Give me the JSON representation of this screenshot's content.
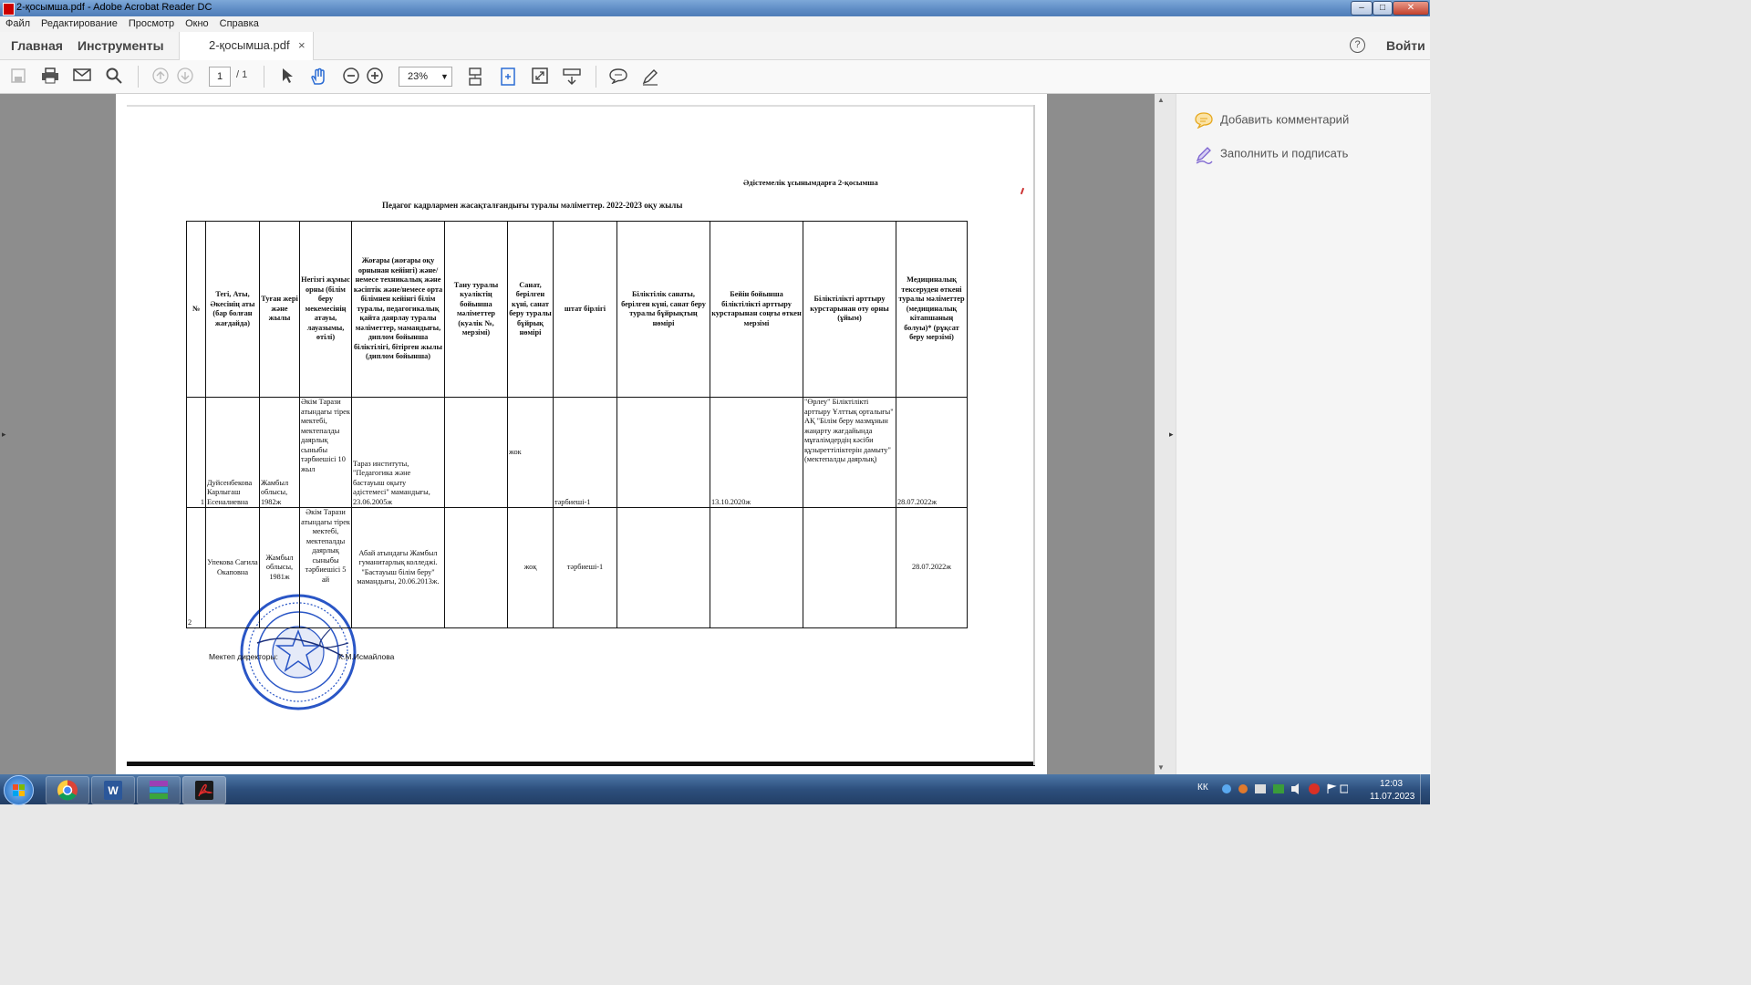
{
  "window": {
    "title": "2-қосымша.pdf - Adobe Acrobat Reader DC",
    "min": "–",
    "max": "□",
    "close": "✕"
  },
  "menu": [
    "Файл",
    "Редактирование",
    "Просмотр",
    "Окно",
    "Справка"
  ],
  "tabs": {
    "home": "Главная",
    "tools": "Инструменты",
    "doc": "2-қосымша.pdf",
    "close": "×",
    "help": "?",
    "signin": "Войти"
  },
  "toolbar": {
    "page_current": "1",
    "page_total": "/ 1",
    "zoom": "23%"
  },
  "right_panel": {
    "add_comment": "Добавить комментарий",
    "fill_sign": "Заполнить и подписать"
  },
  "document": {
    "appendix": "Әдістемелік ұсынымдарға 2-қосымша",
    "title": "Педагог кадрлармен жасақталғандығы туралы мәліметтер. 2022-2023 оқу жылы",
    "headers": [
      "№",
      "Тегі, Аты, Әкесінің аты (бар болған жағдайда)",
      "Туған жері және жылы",
      "Негізгі жұмыс орны (білім беру мекемесінің атауы, лауазымы, өтілі)",
      "Жоғары (жоғары оқу орнынан кейінгі) және/немесе техникалық және кәсіптік және/немесе орта білімнен кейінгі білім туралы, педагогикалық қайта даярлау туралы мәліметтер, мамандығы, диплом бойынша біліктілігі, бітірген жылы (диплом бойынша)",
      "Тану туралы куәліктің бойынша мәліметтер (куәлік №, мерзімі)",
      "Санат, берілген күні, санат беру туралы бұйрық нөмірі",
      "штат бірлігі",
      "Біліктілік санаты, берілген күні, санат беру туралы бұйрықтың нөмірі",
      "Бейін бойынша біліктілікті арттыру курстарынан соңғы өткен мерзімі",
      "Біліктілікті арттыру курстарынан оту орны (ұйым)",
      "Медициналық тексеруден өткені туралы мәліметтер (медициналық кітапшаның болуы)* (рұқсат беру мерзімі)"
    ],
    "rows": [
      {
        "no": "1",
        "name": "Дуйсенбекова Карлыгаш Есеналиевна",
        "birth": "Жамбыл облысы, 1982ж",
        "work": "Әкім Тарази атындағы тірек мектебі, мектепалды даярлық сыныбы тәрбиешісі 10 жыл",
        "education": "Тараз институты, \"Педагогика және бастауыш оқыту әдістемесі\" мамандығы, 23.06.2005ж",
        "recognition": "",
        "category": "жок",
        "staff": "тәрбиеші-1",
        "qual_category": "",
        "course_date": "13.10.2020ж",
        "course_place": "\"Өрлеу\" Біліктілікті арттыру Ұлттық орталығы\" АҚ \"Білім беру мазмұнын жаңарту жағдайында мұғалімдердің кәсіби құзыреттіліктерін дамыту\" (мектепалды даярлық)",
        "medical": "28.07.2022ж"
      },
      {
        "no": "2",
        "name": "Упекова Сағила Окаповна",
        "birth": "Жамбыл облысы, 1981ж",
        "work": "Әкім Тарази атындағы тірек мектебі, мектепалды даярлық сыныбы тәрбиешісі 5 ай",
        "education": "Абай атындағы Жамбыл гуманитарлық колледжі. \"Бастауыш білім беру\" мамандығы, 20.06.2013ж.",
        "recognition": "",
        "category": "жоқ",
        "staff": "тәрбиеші-1",
        "qual_category": "",
        "course_date": "",
        "course_place": "",
        "medical": "28.07.2022ж"
      }
    ],
    "director_label": "Мектеп директоры:",
    "director_name": "К.М.Исмайлова"
  },
  "tray": {
    "lang": "КК",
    "time": "12:03",
    "date": "11.07.2023"
  },
  "colors": {
    "title_bar": "#5d8bc4",
    "taskbar": "#2d4f7d",
    "stamp": "#2a56c6"
  }
}
